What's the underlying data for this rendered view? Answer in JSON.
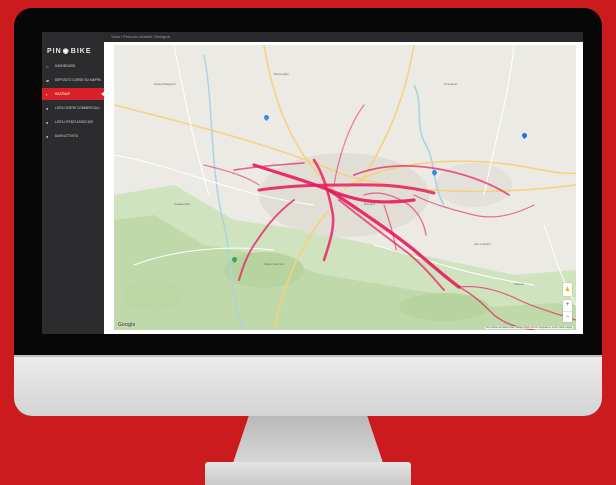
{
  "app": {
    "logo_left": "PIN",
    "logo_right": "BIKE",
    "breadcrumb": "Vista / Percorsi ciclabili / Bologna"
  },
  "sidebar": {
    "items": [
      {
        "label": "DASHBOARD",
        "icon": "home-icon"
      },
      {
        "label": "DEPOSITO CORSE SU MAPPA",
        "icon": "map-icon"
      },
      {
        "label": "HEATMAP",
        "icon": "heat-icon",
        "active": true
      },
      {
        "label": "LISTA CENTRI COMMERCIALI",
        "icon": "store-icon"
      },
      {
        "label": "LISTA UTENTI ASSOCIATI",
        "icon": "users-icon"
      },
      {
        "label": "DIARI ATTIVITÀ",
        "icon": "journal-icon"
      }
    ]
  },
  "map": {
    "brand": "Google",
    "attribution": "Scorciatoie da tastiera   Dati mappa ©2021   Termini   Segnala un errore nella mappa",
    "zoom_in": "+",
    "zoom_out": "−",
    "pegman_icon": "pegman-icon",
    "heat_color": "#e8195f",
    "park_color": "#c8dfb8",
    "water_color": "#aad3df"
  },
  "colors": {
    "background": "#cc1b1f",
    "sidebar": "#2c2c2e",
    "active": "#d91f27"
  }
}
